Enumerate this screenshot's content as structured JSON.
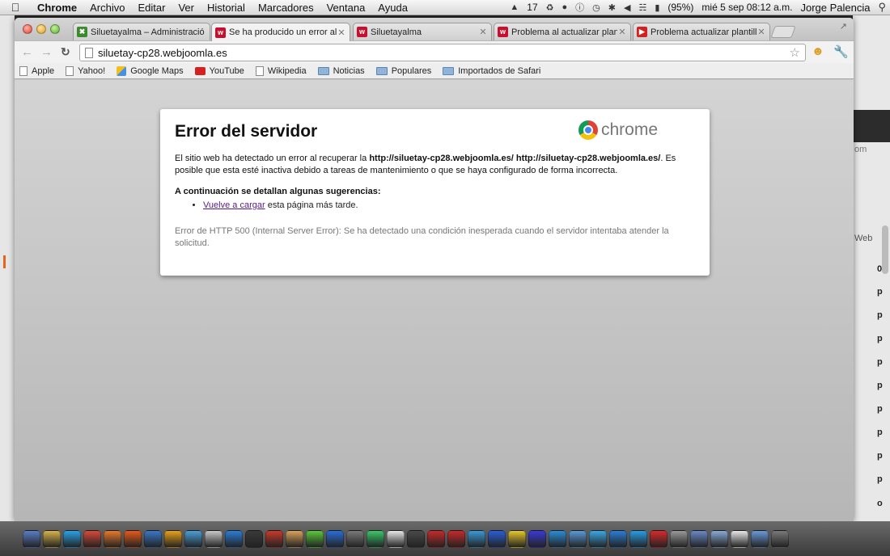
{
  "menubar": {
    "app": "Chrome",
    "items": [
      "Archivo",
      "Editar",
      "Ver",
      "Historial",
      "Marcadores",
      "Ventana",
      "Ayuda"
    ],
    "tray_number": "17",
    "battery": "(95%)",
    "datetime": "mié 5 sep  08:12 a.m.",
    "user": "Jorge Palencia"
  },
  "tabs": [
    {
      "title": "Siluetayalma – Administració",
      "favicon_color": "#3b8a2c"
    },
    {
      "title": "Se ha producido un error al c",
      "favicon_color": "#c8102e"
    },
    {
      "title": "Siluetayalma",
      "favicon_color": "#c8102e"
    },
    {
      "title": "Problema al actualizar planti",
      "favicon_color": "#c8102e"
    },
    {
      "title": "Problema actualizar plantilla",
      "favicon_color": "#d42020"
    }
  ],
  "toolbar": {
    "url": "siluetay-cp28.webjoomla.es"
  },
  "bookmarks": [
    {
      "label": "Apple",
      "icon": "page"
    },
    {
      "label": "Yahoo!",
      "icon": "page"
    },
    {
      "label": "Google Maps",
      "icon": "maps"
    },
    {
      "label": "YouTube",
      "icon": "yt"
    },
    {
      "label": "Wikipedia",
      "icon": "page"
    },
    {
      "label": "Noticias",
      "icon": "folder"
    },
    {
      "label": "Populares",
      "icon": "folder"
    },
    {
      "label": "Importados de Safari",
      "icon": "folder"
    }
  ],
  "error": {
    "title": "Error del servidor",
    "logo_text": "chrome",
    "body_before": "El sitio web ha detectado un error al recuperar la ",
    "body_url": "http://siluetay-cp28.webjoomla.es/ http://siluetay-cp28.webjoomla.es/",
    "body_after": ". Es posible que esta esté inactiva debido a tareas de mantenimiento o que se haya configurado de forma incorrecta.",
    "suggestions_heading": "A continuación se detallan algunas sugerencias:",
    "suggestion_link": "Vuelve a cargar",
    "suggestion_rest": " esta página más tarde.",
    "http_error": "Error de HTTP 500 (Internal Server Error): Se ha detectado una condición inesperada cuando el servidor intentaba atender la solicitud."
  },
  "background_app": {
    "label1": "om",
    "label2": "Web",
    "values": [
      "0",
      "p",
      "p",
      "p",
      "p",
      "p",
      "p",
      "p",
      "p",
      "p",
      "o"
    ]
  },
  "dock_colors": [
    "#5a7ec9",
    "#d9b44a",
    "#2aa3e8",
    "#d94a3a",
    "#e87a2a",
    "#e85a1a",
    "#3a78c9",
    "#e8a21a",
    "#4aa0d9",
    "#c9c9c9",
    "#2a7ed9",
    "#3a3a3a",
    "#c93a2a",
    "#d9a25a",
    "#5ac93a",
    "#2a6ed9",
    "#7a7a7a",
    "#3ac96a",
    "#e8e8e8",
    "#4a4a4a",
    "#c92a2a",
    "#c92a2a",
    "#3a9ad9",
    "#2a5ed9",
    "#e8c92a",
    "#3a3ad9",
    "#2a8ed9",
    "#5a9ad9",
    "#3aa9e8",
    "#2a7ed9",
    "#2a9ee8",
    "#d92a2a",
    "#9a9a9a",
    "#6a8ac9",
    "#8aaad9",
    "#e8e8e8",
    "#6a9ad9",
    "#7a7a7a"
  ]
}
